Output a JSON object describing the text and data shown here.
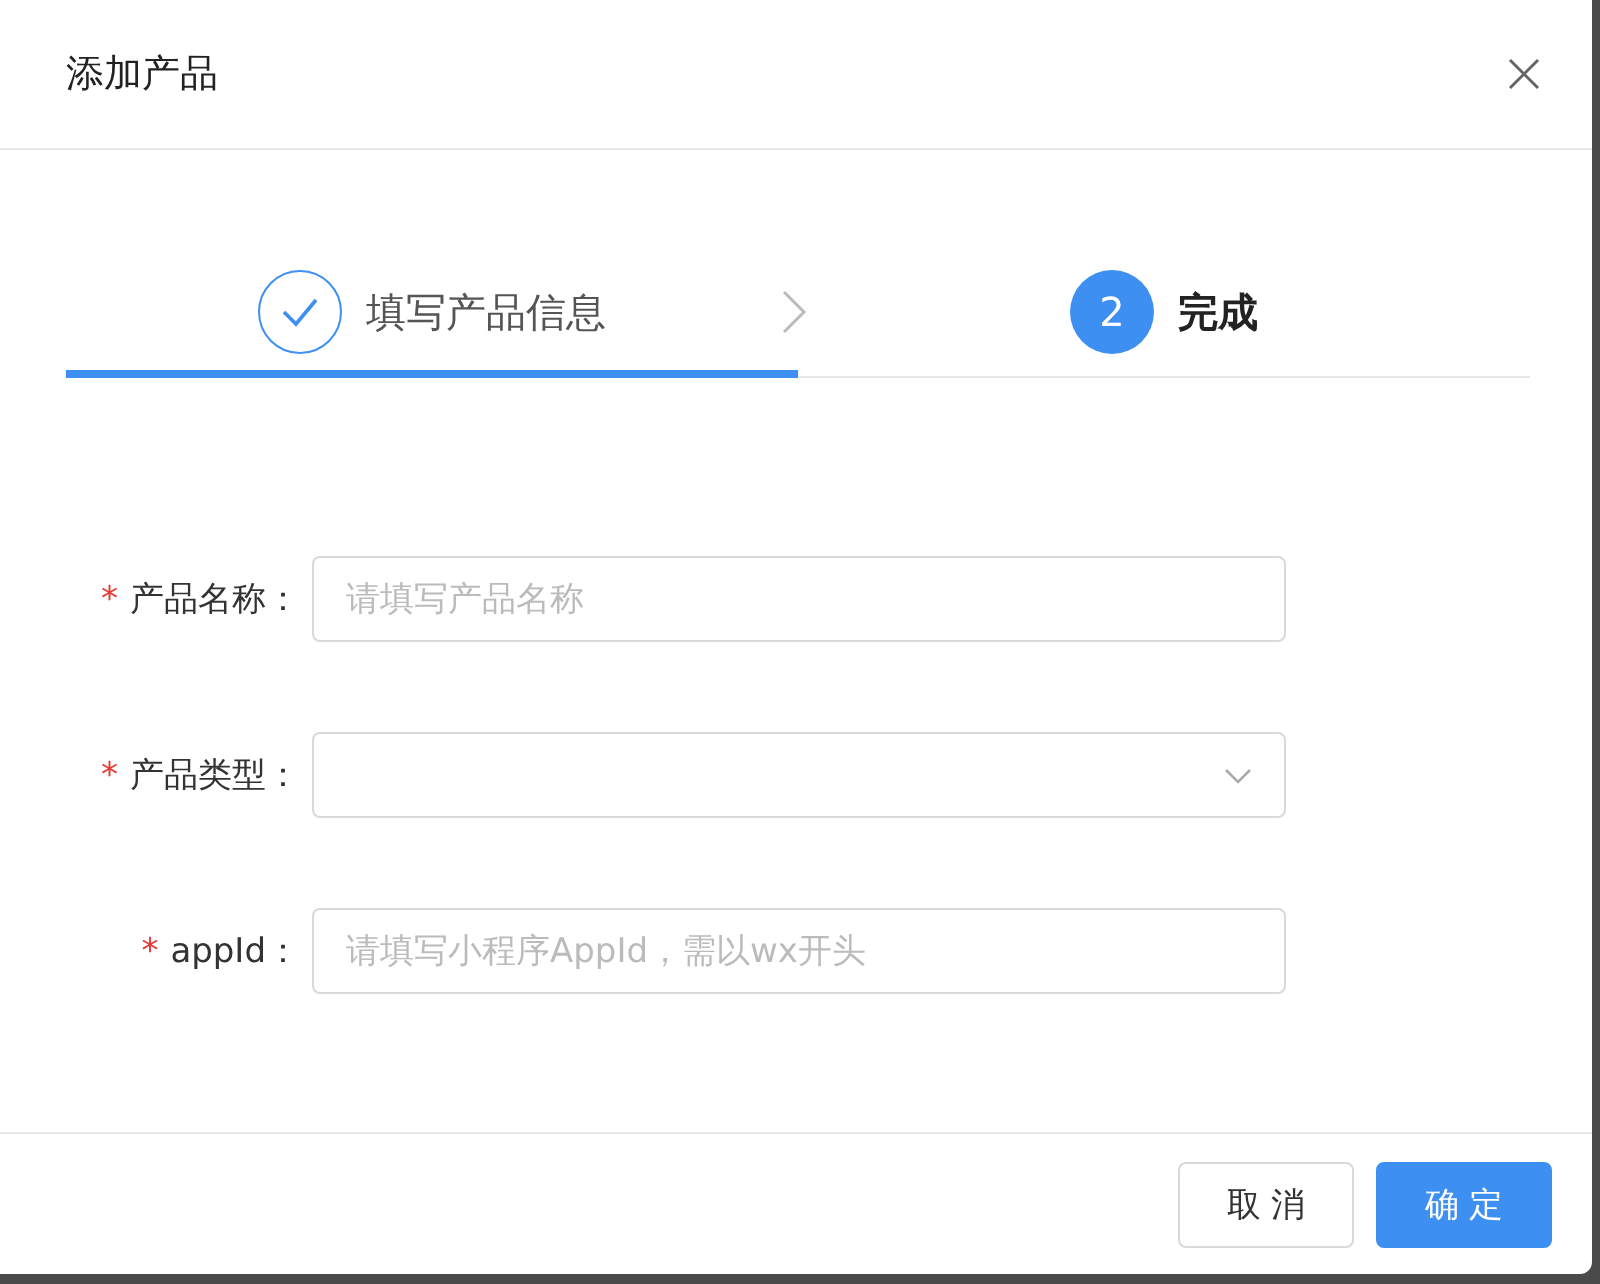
{
  "dialog": {
    "title": "添加产品"
  },
  "steps": [
    {
      "label": "填写产品信息",
      "finished": true,
      "selected": true
    },
    {
      "number": "2",
      "label": "完成",
      "finished": false,
      "selected": false
    }
  ],
  "form": [
    {
      "label": "产品名称",
      "required": true,
      "kind": "text",
      "placeholder": "请填写产品名称"
    },
    {
      "label": "产品类型",
      "required": true,
      "kind": "select"
    },
    {
      "label": "appId",
      "required": true,
      "kind": "text",
      "placeholder": "请填写小程序AppId，需以wx开头"
    }
  ],
  "required_mark": "*",
  "colon": "：",
  "buttons": [
    {
      "label": "取 消",
      "kind": "default"
    },
    {
      "label": "确 定",
      "kind": "primary"
    }
  ]
}
